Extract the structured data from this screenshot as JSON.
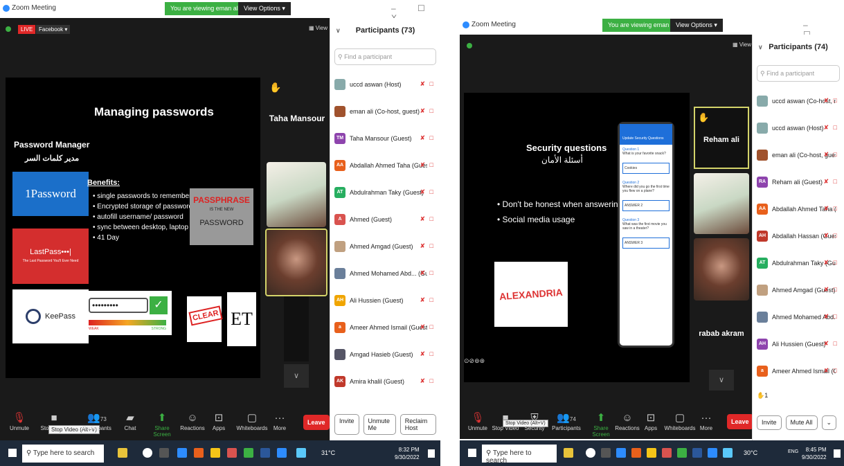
{
  "left": {
    "title": "Zoom Meeting",
    "viewing_banner": "You are viewing eman ali's screen",
    "view_options": "View Options",
    "window_controls": "–  ☐  X",
    "live_badge": "LIVE",
    "live_target": "Facebook",
    "view_label": "View",
    "slide": {
      "title": "Managing passwords",
      "left_heading": "Password Manager",
      "left_heading_ar": "مدير كلمات السر",
      "onepassword": "1Password",
      "lastpass": "LastPass•••|",
      "lastpass_sub": "The Last Password You'll Ever Need",
      "keepass": "KeePass",
      "benefits_title": "Benefits:",
      "benefits": [
        "single passwords to remember",
        "Encrypted storage of passwords",
        "autofill username/ password",
        "sync between desktop, laptop",
        "41 Day"
      ],
      "passphrase_top": "PASSPHRASE",
      "passphrase_mid": "IS THE NEW",
      "passphrase_bottom": "PASSWORD",
      "dots": "•••••••••",
      "weak": "WEAK",
      "strong": "STRONG",
      "clear": "CLEAR"
    },
    "speaker_name": "Taha Mansour",
    "toolbar": {
      "unmute": "Unmute",
      "stop_video": "Stop Video",
      "tooltip": "Stop Video (Alt+V)",
      "participants": "Participants",
      "participants_count": "73",
      "chat": "Chat",
      "share": "Share Screen",
      "reactions": "Reactions",
      "apps": "Apps",
      "whiteboards": "Whiteboards",
      "more": "More",
      "leave": "Leave"
    },
    "panel": {
      "title": "Participants (73)",
      "search_placeholder": "Find a participant",
      "rows": [
        {
          "initials": "",
          "name": "uccd aswan (Host)",
          "color": "#8aa"
        },
        {
          "initials": "",
          "name": "eman ali (Co-host, guest)",
          "color": "#a0522d"
        },
        {
          "initials": "TM",
          "name": "Taha Mansour (Guest)",
          "color": "#8e44ad"
        },
        {
          "initials": "AA",
          "name": "Abdallah Ahmed Taha (Guest)",
          "color": "#e8601c"
        },
        {
          "initials": "AT",
          "name": "Abdulrahman Taky (Guest)",
          "color": "#27ae60"
        },
        {
          "initials": "A",
          "name": "Ahmed (Guest)",
          "color": "#d9534f"
        },
        {
          "initials": "",
          "name": "Ahmed Amgad (Guest)",
          "color": "#c0a080"
        },
        {
          "initials": "",
          "name": "Ahmed Mohamed Abd... (Guest)",
          "color": "#6a7f9a"
        },
        {
          "initials": "AH",
          "name": "Ali Hussien (Guest)",
          "color": "#f0a500"
        },
        {
          "initials": "a",
          "name": "Ameer Ahmed Ismail (Guest)",
          "color": "#e8601c"
        },
        {
          "initials": "",
          "name": "Amgad Hasieb (Guest)",
          "color": "#556"
        },
        {
          "initials": "AK",
          "name": "Amira khalil (Guest)",
          "color": "#c0392b"
        }
      ],
      "invite": "Invite",
      "unmute_me": "Unmute Me",
      "reclaim_host": "Reclaim Host"
    },
    "taskbar": {
      "search": "Type here to search",
      "temp": "31°C",
      "time": "8:32 PM",
      "date": "9/30/2022"
    }
  },
  "right": {
    "title": "Zoom Meeting",
    "viewing_banner": "You are viewing eman ali's screen",
    "view_options": "View Options",
    "window_controls": "–  ☐  X",
    "view_label": "View",
    "slide": {
      "title": "Security questions",
      "title_ar": "أسئلة الأمان",
      "bullets": [
        "Don't be honest when answering.",
        "Social media usage"
      ],
      "alexandria": "ALEXANDRIA",
      "phone_header": "Update Security Questions",
      "q1": "Question 1",
      "q1_text": "What is your favorite snack?",
      "q1_answer": "Cookies",
      "q2": "Question 2",
      "q2_text": "Where did you go the first time you flew on a plane?",
      "q2_answer": "ANSWER 2",
      "q3": "Question 3",
      "q3_text": "What was the first movie you saw in a theater?",
      "q3_answer": "ANSWER 3"
    },
    "speaker_name": "Reham ali",
    "speaker_name_2": "rabab akram",
    "toolbar": {
      "unmute": "Unmute",
      "stop_video": "Stop Video",
      "tooltip": "Stop Video (Alt+V)",
      "security": "Security",
      "participants": "Participants",
      "participants_count": "74",
      "share": "Share Screen",
      "reactions": "Reactions",
      "apps": "Apps",
      "whiteboards": "Whiteboards",
      "more": "More",
      "leave": "Leave"
    },
    "panel": {
      "title": "Participants (74)",
      "search_placeholder": "Find a participant",
      "rows": [
        {
          "initials": "",
          "name": "uccd aswan (Co-host, me)",
          "color": "#8aa"
        },
        {
          "initials": "",
          "name": "uccd aswan (Host)",
          "color": "#8aa"
        },
        {
          "initials": "",
          "name": "eman ali (Co-host, guest)",
          "color": "#a0522d"
        },
        {
          "initials": "RA",
          "name": "Reham ali (Guest)",
          "color": "#8e44ad"
        },
        {
          "initials": "AA",
          "name": "Abdallah Ahmed Taha (Guest)",
          "color": "#e8601c"
        },
        {
          "initials": "AH",
          "name": "Abdallah Hassan (Guest)",
          "color": "#c0392b"
        },
        {
          "initials": "AT",
          "name": "Abdulrahman Taky (Guest)",
          "color": "#27ae60"
        },
        {
          "initials": "",
          "name": "Ahmed Amgad (Guest)",
          "color": "#c0a080"
        },
        {
          "initials": "",
          "name": "Ahmed Mohamed Abd... (Guest)",
          "color": "#6a7f9a"
        },
        {
          "initials": "AH",
          "name": "Ali Hussien (Guest)",
          "color": "#8e44ad"
        },
        {
          "initials": "a",
          "name": "Ameer Ahmed Ismail (Guest)",
          "color": "#e8601c"
        }
      ],
      "raise_count": "1",
      "invite": "Invite",
      "mute_all": "Mute All"
    },
    "taskbar": {
      "search": "Type here to search",
      "temp": "30°C",
      "lang": "ENG",
      "time": "8:45 PM",
      "date": "9/30/2022"
    }
  }
}
